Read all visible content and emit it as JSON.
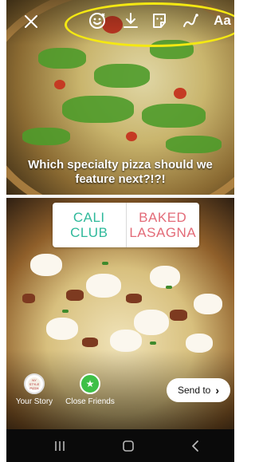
{
  "story": {
    "caption": "Which specialty pizza should we feature next?!?!",
    "poll": {
      "option_a": "CALI\nCLUB",
      "option_b": "BAKED\nLASAGNA",
      "color_a": "#2fb99b",
      "color_b": "#e36b78"
    }
  },
  "top_bar": {
    "close_icon": "close-icon",
    "tools": [
      "emoji-face-sticker-icon",
      "download-icon",
      "sticker-icon",
      "draw-squiggle-icon"
    ],
    "text_tool_label": "Aa",
    "highlight_color": "#f4e812"
  },
  "share": {
    "your_story_label": "Your Story",
    "close_friends_label": "Close Friends",
    "send_to_label": "Send to",
    "avatar_logo_text": "NY STYLE PIZZA"
  },
  "navbar": {
    "recents_icon": "recents-icon",
    "home_icon": "home-icon",
    "back_icon": "back-icon"
  }
}
